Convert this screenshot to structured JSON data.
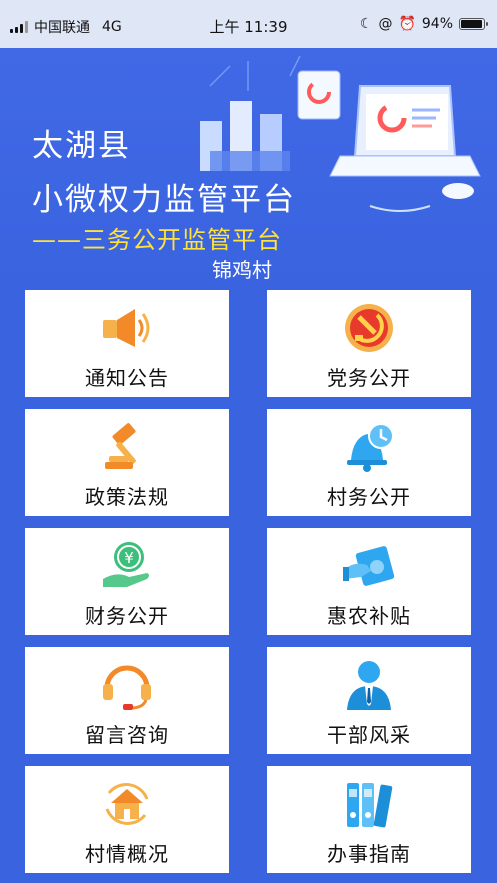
{
  "status_bar": {
    "carrier": "中国联通",
    "network": "4G",
    "time": "上午 11:39",
    "battery": "94%",
    "battery_level": 0.94
  },
  "header": {
    "county": "太湖县",
    "platform": "小微权力监管平台",
    "subtitle": "——三务公开监管平台",
    "village": "锦鸡村"
  },
  "tiles": [
    {
      "label": "通知公告",
      "icon": "megaphone-icon"
    },
    {
      "label": "党务公开",
      "icon": "party-emblem-icon"
    },
    {
      "label": "政策法规",
      "icon": "gavel-icon"
    },
    {
      "label": "村务公开",
      "icon": "bell-clock-icon"
    },
    {
      "label": "财务公开",
      "icon": "coin-hand-icon"
    },
    {
      "label": "惠农补贴",
      "icon": "subsidy-card-icon"
    },
    {
      "label": "留言咨询",
      "icon": "headset-icon"
    },
    {
      "label": "干部风采",
      "icon": "official-person-icon"
    },
    {
      "label": "村情概况",
      "icon": "home-refresh-icon"
    },
    {
      "label": "办事指南",
      "icon": "binders-icon"
    }
  ],
  "colors": {
    "background": "#3a63e0",
    "subtitle": "#ffe23a",
    "icon_orange": "#f29a2e",
    "icon_blue": "#2fa7f0",
    "icon_green": "#3cbf7a"
  }
}
